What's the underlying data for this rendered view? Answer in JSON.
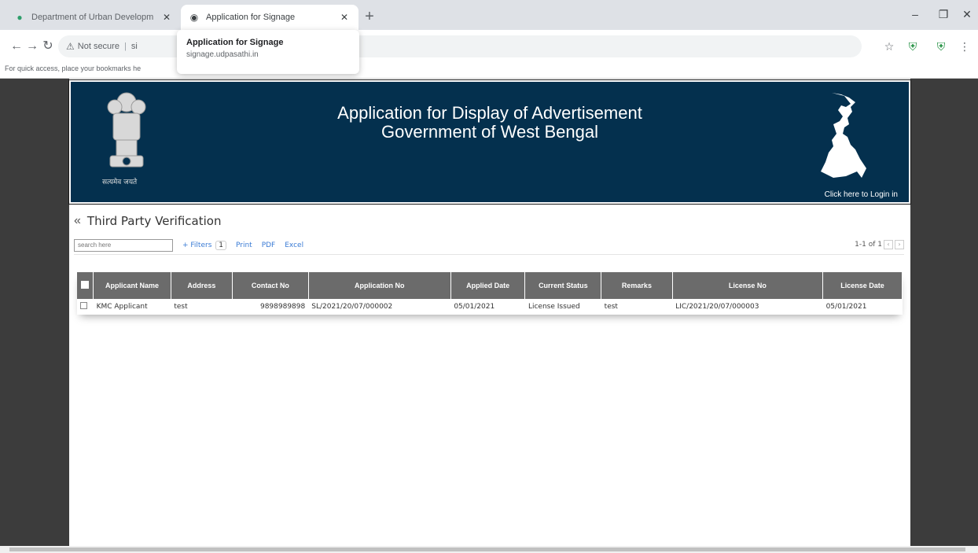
{
  "browser": {
    "tabs": [
      {
        "title": "Department of Urban Developm",
        "active": false
      },
      {
        "title": "Application for Signage",
        "active": true
      }
    ],
    "hover_card": {
      "title": "Application for Signage",
      "url": "signage.udpasathi.in"
    },
    "omnibox": {
      "security": "Not secure",
      "url": "si"
    },
    "bookmarks_hint": "For quick access, place your bookmarks he"
  },
  "header": {
    "title_line1": "Application for Display of Advertisement",
    "title_line2": "Government of West Bengal",
    "emblem_caption": "सत्यमेव जयते",
    "login_link": "Click here to Login in"
  },
  "section": {
    "title": "Third Party Verification"
  },
  "toolbar": {
    "search_placeholder": "search here",
    "filters_label": "+ Filters",
    "filters_count": "1",
    "print": "Print",
    "pdf": "PDF",
    "excel": "Excel",
    "pager": "1-1 of 1"
  },
  "table": {
    "columns": [
      "Applicant Name",
      "Address",
      "Contact No",
      "Application No",
      "Applied Date",
      "Current Status",
      "Remarks",
      "License No",
      "License Date"
    ],
    "rows": [
      [
        "KMC Applicant",
        "test",
        "9898989898",
        "SL/2021/20/07/000002",
        "05/01/2021",
        "License Issued",
        "test",
        "LIC/2021/20/07/000003",
        "05/01/2021"
      ]
    ]
  },
  "colors": {
    "banner": "#04304e",
    "table_header": "#6b6b6b",
    "link": "#3a7bd5"
  }
}
